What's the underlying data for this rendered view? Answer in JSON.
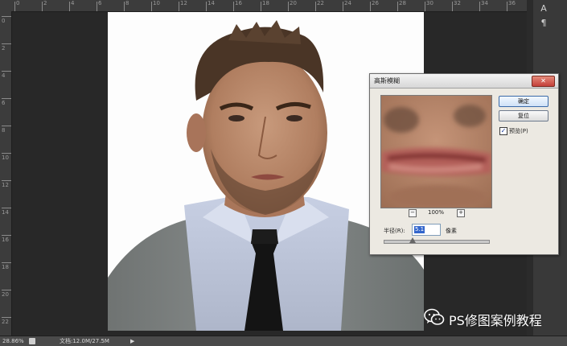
{
  "ruler": {
    "top_labels": [
      "0",
      "2",
      "4",
      "6",
      "8",
      "10",
      "12",
      "14",
      "16",
      "18",
      "20",
      "22",
      "24",
      "26",
      "28",
      "30",
      "32",
      "34",
      "36"
    ],
    "left_labels": [
      "0",
      "2",
      "4",
      "6",
      "8",
      "10",
      "12",
      "14",
      "16",
      "18",
      "20",
      "22"
    ]
  },
  "dock": {
    "icon_label": "A",
    "icon2_label": "¶"
  },
  "status": {
    "zoom": "28.86%",
    "doc_info": "文档:12.0M/27.5M",
    "arrow": "▶"
  },
  "dialog": {
    "title": "高斯模糊",
    "close_glyph": "✕",
    "ok_label": "确定",
    "reset_label": "复位",
    "preview_checked": "✓",
    "preview_label": "预览(P)",
    "zoom_out": "−",
    "zoom_in": "+",
    "zoom_level": "100%",
    "radius_label": "半径(R):",
    "radius_value": "5.1",
    "unit_label": "像素"
  },
  "watermark": {
    "text": "PS修图案例教程",
    "icon": "wechat-icon"
  },
  "colors": {
    "app_bg": "#282828",
    "dialog_bg": "#ece9e2",
    "selection": "#3366cc"
  }
}
